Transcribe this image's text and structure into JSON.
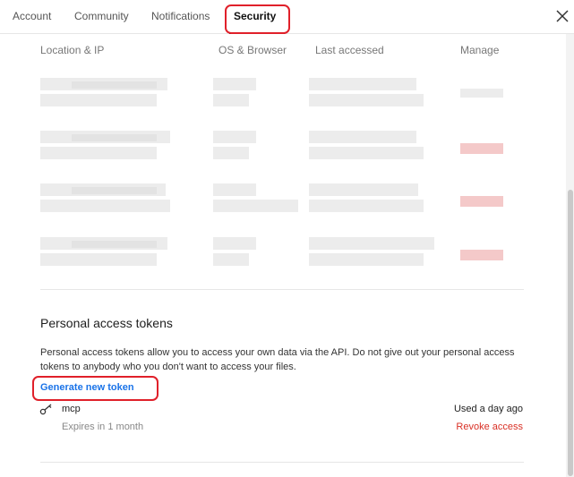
{
  "tabs": [
    {
      "label": "Account"
    },
    {
      "label": "Community"
    },
    {
      "label": "Notifications"
    },
    {
      "label": "Security"
    }
  ],
  "active_tab": "Security",
  "icons": {
    "close": "close-icon",
    "key": "key-icon"
  },
  "sessions": {
    "columns": [
      "Location & IP",
      "OS & Browser",
      "Last accessed",
      "Manage"
    ]
  },
  "tokens": {
    "title": "Personal access tokens",
    "description": "Personal access tokens allow you to access your own data via the API. Do not give out your personal access tokens to anybody who you don't want to access your files.",
    "generate_label": "Generate new token",
    "items": [
      {
        "name": "mcp",
        "expires": "Expires in 1 month",
        "used": "Used a day ago",
        "revoke_label": "Revoke access"
      }
    ]
  },
  "colors": {
    "accent": "#1a73e8",
    "danger": "#d93025",
    "highlight": "#e0202a"
  }
}
